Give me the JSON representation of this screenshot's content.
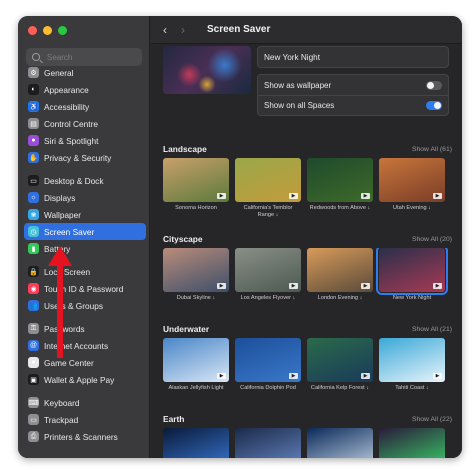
{
  "window": {
    "traffic_colors": [
      "#ff5f57",
      "#febc2e",
      "#28c840"
    ]
  },
  "sidebar": {
    "search_placeholder": "Search",
    "groups": [
      [
        {
          "label": "General",
          "icon": "gear-icon",
          "color": "#8e8e93"
        },
        {
          "label": "Appearance",
          "icon": "appearance-icon",
          "color": "#1c1c1e"
        },
        {
          "label": "Accessibility",
          "icon": "accessibility-icon",
          "color": "#1a7cf5"
        },
        {
          "label": "Control Centre",
          "icon": "control-centre-icon",
          "color": "#8e8e93"
        },
        {
          "label": "Siri & Spotlight",
          "icon": "siri-icon",
          "color": "#9b4cd9"
        },
        {
          "label": "Privacy & Security",
          "icon": "hand-icon",
          "color": "#2f6fe0"
        }
      ],
      [
        {
          "label": "Desktop & Dock",
          "icon": "dock-icon",
          "color": "#1c1c1e"
        },
        {
          "label": "Displays",
          "icon": "display-icon",
          "color": "#2f6fe0"
        },
        {
          "label": "Wallpaper",
          "icon": "wallpaper-icon",
          "color": "#35a5e8"
        },
        {
          "label": "Screen Saver",
          "icon": "screen-saver-icon",
          "color": "#44c2d8",
          "active": true
        },
        {
          "label": "Battery",
          "icon": "battery-icon",
          "color": "#34c759"
        }
      ],
      [
        {
          "label": "Lock Screen",
          "icon": "lock-icon",
          "color": "#1c1c1e"
        },
        {
          "label": "Touch ID & Password",
          "icon": "fingerprint-icon",
          "color": "#ff3b58"
        },
        {
          "label": "Users & Groups",
          "icon": "users-icon",
          "color": "#2f6fe0"
        }
      ],
      [
        {
          "label": "Passwords",
          "icon": "key-icon",
          "color": "#8e8e93"
        },
        {
          "label": "Internet Accounts",
          "icon": "at-icon",
          "color": "#2f6fe0"
        },
        {
          "label": "Game Center",
          "icon": "game-center-icon",
          "color": "#e8e8ea"
        },
        {
          "label": "Wallet & Apple Pay",
          "icon": "wallet-icon",
          "color": "#1c1c1e"
        }
      ],
      [
        {
          "label": "Keyboard",
          "icon": "keyboard-icon",
          "color": "#8e8e93"
        },
        {
          "label": "Trackpad",
          "icon": "trackpad-icon",
          "color": "#8e8e93"
        },
        {
          "label": "Printers & Scanners",
          "icon": "printer-icon",
          "color": "#8e8e93"
        }
      ]
    ]
  },
  "header": {
    "back": "‹",
    "forward": "›",
    "title": "Screen Saver"
  },
  "current": {
    "name": "New York Night",
    "options": [
      {
        "label": "Show as wallpaper",
        "on": false
      },
      {
        "label": "Show on all Spaces",
        "on": true
      }
    ]
  },
  "sections": [
    {
      "title": "Landscape",
      "show_all": "Show All (61)",
      "items": [
        {
          "caption": "Sonoma Horizon",
          "colors": [
            "#c7a06a",
            "#5d7a3c"
          ]
        },
        {
          "caption": "California's Temblor Range ↓",
          "colors": [
            "#9aa84a",
            "#c39b3a"
          ]
        },
        {
          "caption": "Redwoods from Above ↓",
          "colors": [
            "#1f4a2c",
            "#3e6a2a"
          ]
        },
        {
          "caption": "Utah Evening ↓",
          "colors": [
            "#c8763a",
            "#7a3d28"
          ]
        }
      ]
    },
    {
      "title": "Cityscape",
      "show_all": "Show All (20)",
      "items": [
        {
          "caption": "Dubai Skyline ↓",
          "colors": [
            "#b98c7a",
            "#3d4f6a"
          ]
        },
        {
          "caption": "Los Angeles Flyover ↓",
          "colors": [
            "#8a8f86",
            "#4b5a52"
          ]
        },
        {
          "caption": "London Evening ↓",
          "colors": [
            "#d89b5a",
            "#5a4a3a"
          ]
        },
        {
          "caption": "New York Night",
          "colors": [
            "#2a2f4a",
            "#a83a55"
          ],
          "selected": true
        }
      ]
    },
    {
      "title": "Underwater",
      "show_all": "Show All (21)",
      "items": [
        {
          "caption": "Alaskan Jellyfish Light",
          "colors": [
            "#4a86c8",
            "#d8e6f5"
          ]
        },
        {
          "caption": "California Dolphin Pod",
          "colors": [
            "#1c4f9a",
            "#3a78c8"
          ]
        },
        {
          "caption": "California Kelp Forest ↓",
          "colors": [
            "#2a6a4a",
            "#1a3a5a"
          ]
        },
        {
          "caption": "Tahiti Coast ↓",
          "colors": [
            "#3aa8d8",
            "#e8f4fa"
          ]
        }
      ]
    },
    {
      "title": "Earth",
      "show_all": "Show All (22)",
      "items": [
        {
          "caption": "",
          "colors": [
            "#0a1a3a",
            "#3a7ad8"
          ]
        },
        {
          "caption": "",
          "colors": [
            "#1a2a4a",
            "#6a8ac8"
          ]
        },
        {
          "caption": "",
          "colors": [
            "#0a2a5a",
            "#c8d8e8"
          ]
        },
        {
          "caption": "",
          "colors": [
            "#2a1a3a",
            "#3ad86a"
          ]
        }
      ]
    }
  ],
  "annotation": {
    "arrow_color": "#e5121f"
  }
}
